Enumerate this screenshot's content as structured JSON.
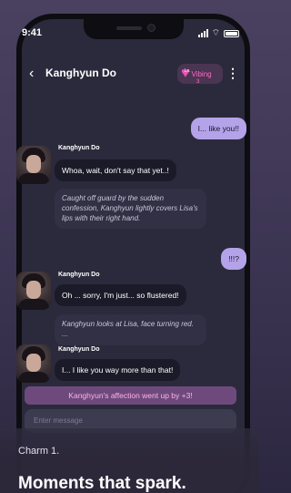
{
  "status": {
    "time": "9:41"
  },
  "header": {
    "title": "Kanghyun Do",
    "vibe_label": "Vibing",
    "vibe_level": "Lv.",
    "vibe_number": "3"
  },
  "messages": [
    {
      "type": "user",
      "text": "I... like you!!"
    },
    {
      "type": "char",
      "sender": "Kanghyun Do",
      "text": "Whoa, wait, don't say that yet..!"
    },
    {
      "type": "narration",
      "text": "Caught off guard by the sudden confession, Kanghyun lightly covers Lisa's lips with their right hand."
    },
    {
      "type": "user",
      "text": "!!!?"
    },
    {
      "type": "char",
      "sender": "Kanghyun Do",
      "text": "Oh ... sorry, I'm just... so flustered!"
    },
    {
      "type": "narration",
      "text": "Kanghyun looks at Lisa, face turning red. ..."
    },
    {
      "type": "char",
      "sender": "Kanghyun Do",
      "text": "I... I like you way more than that!"
    }
  ],
  "affection_banner": "Kanghyun's affection went up by +3!",
  "input": {
    "placeholder": "Enter message"
  },
  "caption": {
    "subtitle": "Charm 1.",
    "headline": "Moments that spark."
  },
  "colors": {
    "user_bubble": "#b4a3e8",
    "affection_text": "#ffb2e6",
    "vibe_accent": "#ff6ac8"
  }
}
